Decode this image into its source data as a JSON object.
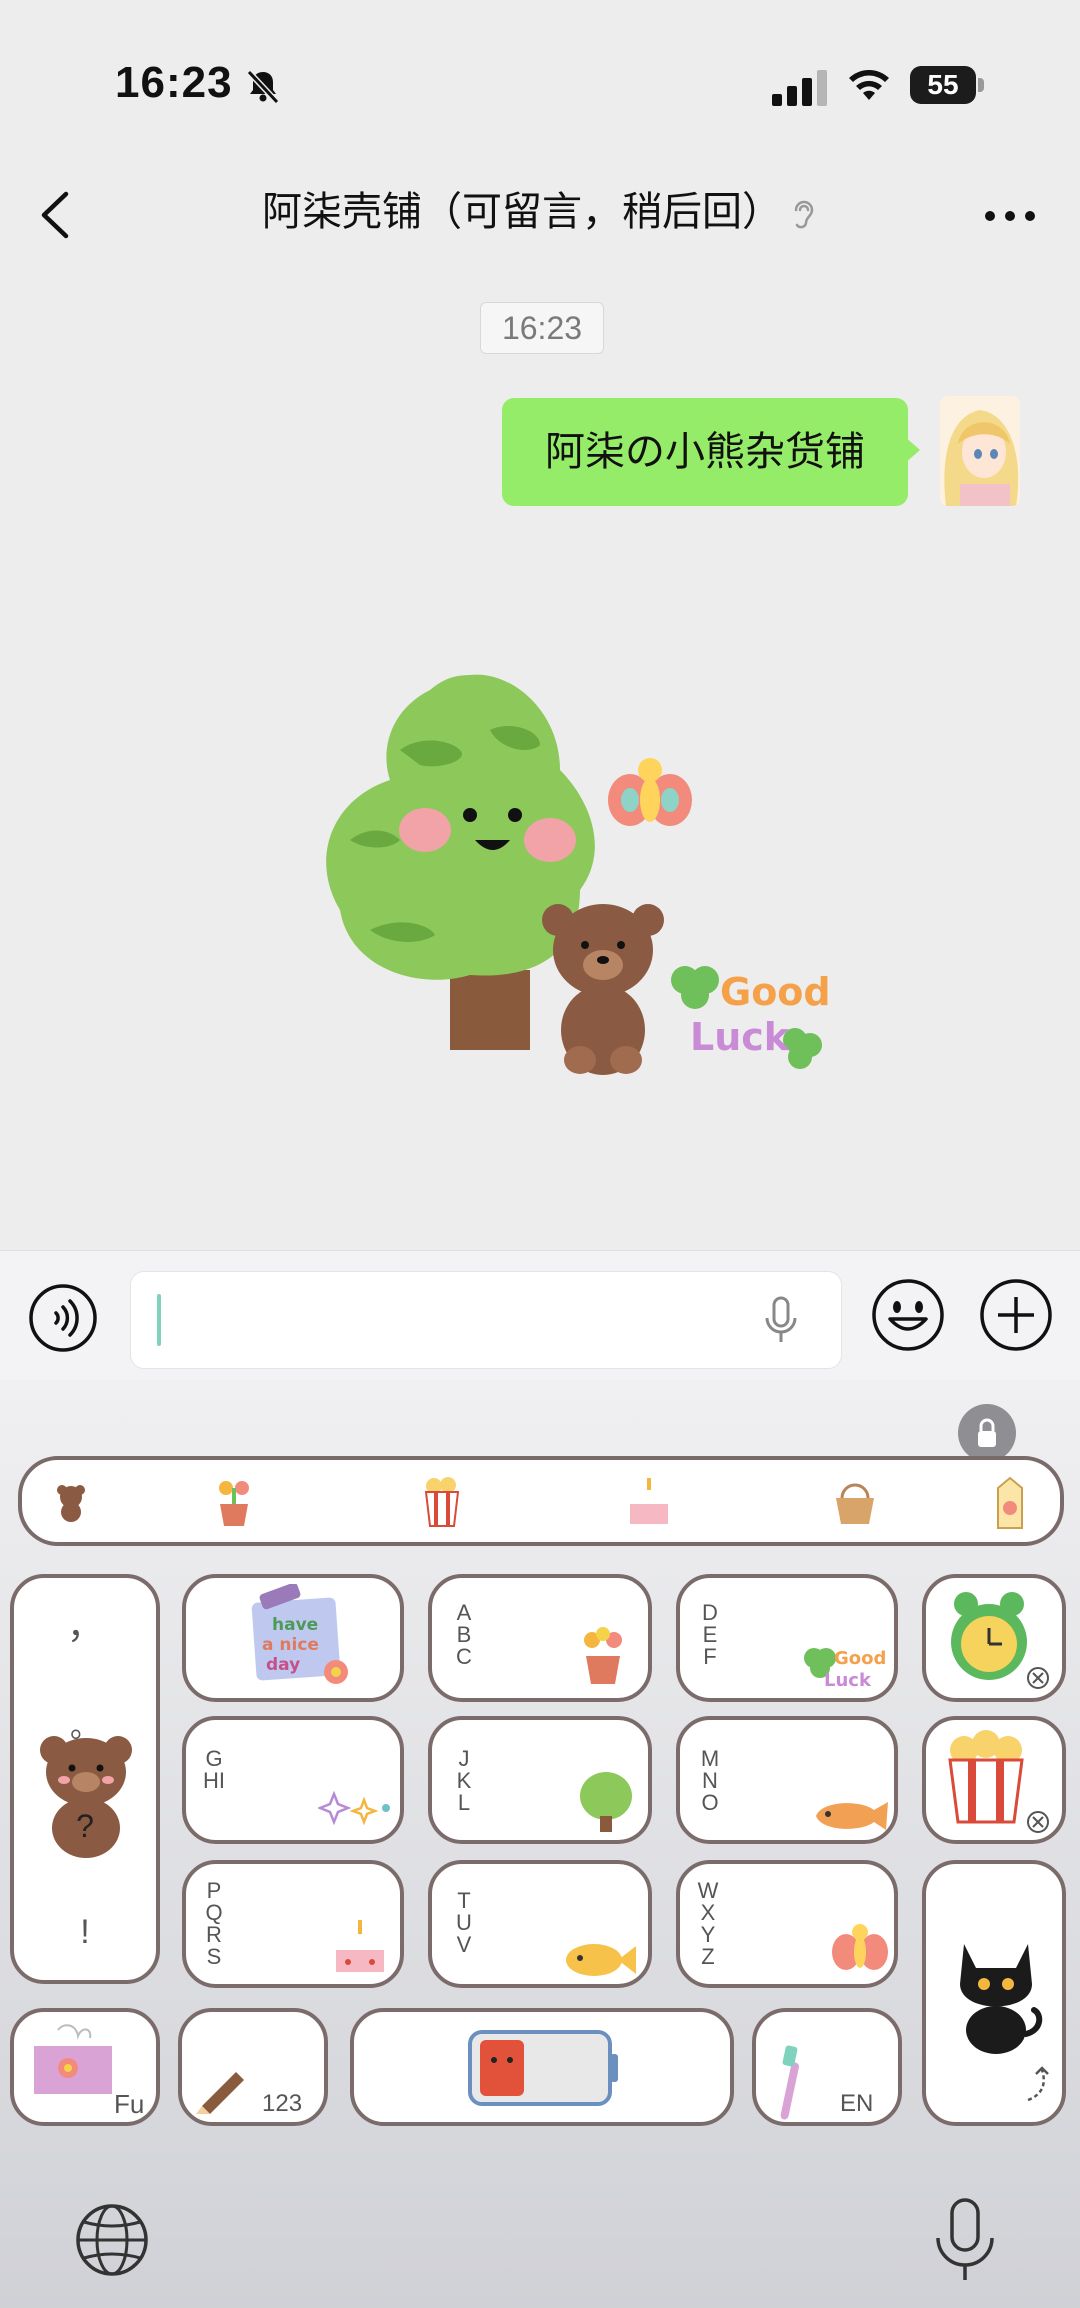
{
  "status_bar": {
    "time": "16:23",
    "battery_level": "55",
    "icons": [
      "bell-muted-icon",
      "signal-icon",
      "wifi-icon",
      "battery-icon"
    ]
  },
  "nav": {
    "title": "阿柒壳铺（可留言，稍后回）",
    "back_icon": "chevron-left-icon",
    "more_icon": "more-dots-icon",
    "ear_icon": "ear-icon"
  },
  "chat": {
    "timestamp": "16:23",
    "messages": [
      {
        "from": "me",
        "type": "text",
        "text": "阿柒の小熊杂货铺"
      },
      {
        "from": "me",
        "type": "sticker",
        "caption": "Good Luck"
      }
    ]
  },
  "input": {
    "placeholder": "",
    "value": ""
  },
  "keyboard": {
    "strip_stickers": [
      "bear",
      "flower-pot",
      "popcorn",
      "cake",
      "basket",
      "juice-box"
    ],
    "punct_key": {
      "top": "，",
      "mid": "。",
      "q": "?",
      "bottom": "!"
    },
    "keys": [
      {
        "id": "have-nice-day",
        "label": "have a nice day"
      },
      {
        "id": "abc",
        "label": "ABC"
      },
      {
        "id": "def",
        "label": "DEF"
      },
      {
        "id": "ghi",
        "label": "GHI"
      },
      {
        "id": "jkl",
        "label": "JKL"
      },
      {
        "id": "mno",
        "label": "MNO"
      },
      {
        "id": "pqrs",
        "label": "PQRS"
      },
      {
        "id": "tuv",
        "label": "TUV"
      },
      {
        "id": "wxyz",
        "label": "WXYZ"
      }
    ],
    "fu_label": "Fu",
    "num_label": "123",
    "en_label": "EN",
    "colors": {
      "key_border": "#7b6b6b",
      "bubble": "#95ec69"
    }
  }
}
